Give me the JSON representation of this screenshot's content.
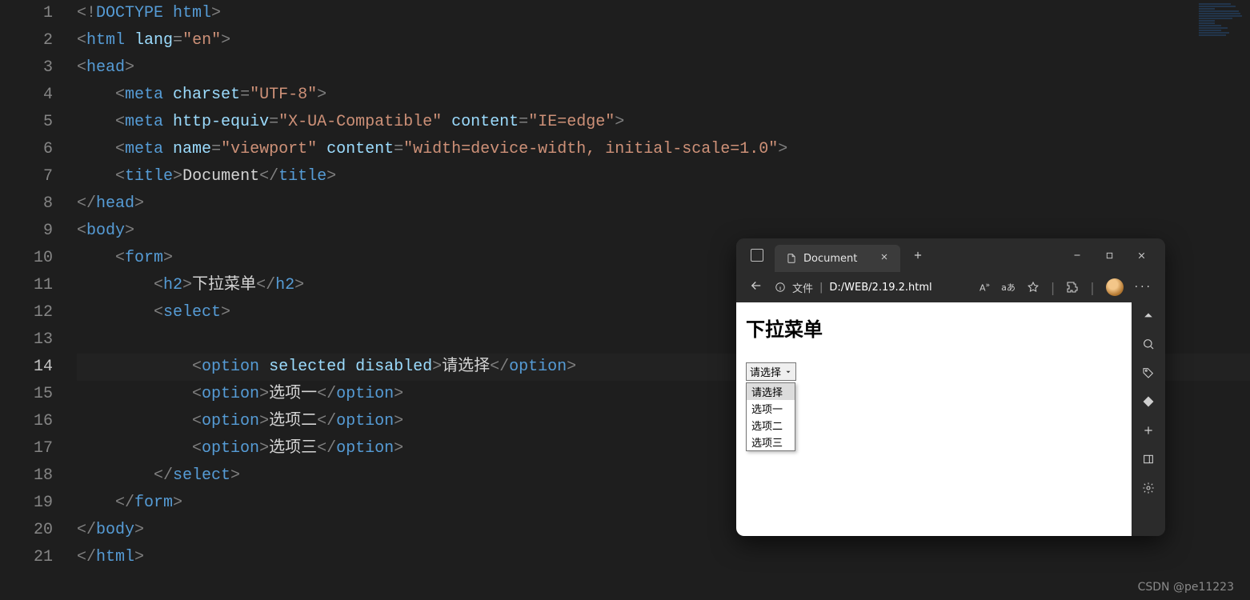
{
  "editor": {
    "currentLine": 14,
    "lines": [
      {
        "t": [
          [
            "brk",
            "<!"
          ],
          [
            "doctype",
            "DOCTYPE "
          ],
          [
            "tag",
            "html"
          ],
          [
            "brk",
            ">"
          ]
        ]
      },
      {
        "t": [
          [
            "brk",
            "<"
          ],
          [
            "tag",
            "html "
          ],
          [
            "attr",
            "lang"
          ],
          [
            "brk",
            "="
          ],
          [
            "str",
            "\"en\""
          ],
          [
            "brk",
            ">"
          ]
        ]
      },
      {
        "t": [
          [
            "brk",
            "<"
          ],
          [
            "tag",
            "head"
          ],
          [
            "brk",
            ">"
          ]
        ]
      },
      {
        "indent": 1,
        "t": [
          [
            "brk",
            "<"
          ],
          [
            "tag",
            "meta "
          ],
          [
            "attr",
            "charset"
          ],
          [
            "brk",
            "="
          ],
          [
            "str",
            "\"UTF-8\""
          ],
          [
            "brk",
            ">"
          ]
        ]
      },
      {
        "indent": 1,
        "t": [
          [
            "brk",
            "<"
          ],
          [
            "tag",
            "meta "
          ],
          [
            "attr",
            "http-equiv"
          ],
          [
            "brk",
            "="
          ],
          [
            "str",
            "\"X-UA-Compatible\""
          ],
          [
            "txt",
            " "
          ],
          [
            "attr",
            "content"
          ],
          [
            "brk",
            "="
          ],
          [
            "str",
            "\"IE=edge\""
          ],
          [
            "brk",
            ">"
          ]
        ]
      },
      {
        "indent": 1,
        "t": [
          [
            "brk",
            "<"
          ],
          [
            "tag",
            "meta "
          ],
          [
            "attr",
            "name"
          ],
          [
            "brk",
            "="
          ],
          [
            "str",
            "\"viewport\""
          ],
          [
            "txt",
            " "
          ],
          [
            "attr",
            "content"
          ],
          [
            "brk",
            "="
          ],
          [
            "str",
            "\"width=device-width, initial-scale=1.0\""
          ],
          [
            "brk",
            ">"
          ]
        ]
      },
      {
        "indent": 1,
        "t": [
          [
            "brk",
            "<"
          ],
          [
            "tag",
            "title"
          ],
          [
            "brk",
            ">"
          ],
          [
            "txt",
            "Document"
          ],
          [
            "brk",
            "</"
          ],
          [
            "tag",
            "title"
          ],
          [
            "brk",
            ">"
          ]
        ]
      },
      {
        "t": [
          [
            "brk",
            "</"
          ],
          [
            "tag",
            "head"
          ],
          [
            "brk",
            ">"
          ]
        ]
      },
      {
        "t": [
          [
            "brk",
            "<"
          ],
          [
            "tag",
            "body"
          ],
          [
            "brk",
            ">"
          ]
        ]
      },
      {
        "indent": 1,
        "t": [
          [
            "brk",
            "<"
          ],
          [
            "tag",
            "form"
          ],
          [
            "brk",
            ">"
          ]
        ]
      },
      {
        "indent": 2,
        "t": [
          [
            "brk",
            "<"
          ],
          [
            "tag",
            "h2"
          ],
          [
            "brk",
            ">"
          ],
          [
            "txt",
            "下拉菜单"
          ],
          [
            "brk",
            "</"
          ],
          [
            "tag",
            "h2"
          ],
          [
            "brk",
            ">"
          ]
        ]
      },
      {
        "indent": 2,
        "t": [
          [
            "brk",
            "<"
          ],
          [
            "tag",
            "select"
          ],
          [
            "brk",
            ">"
          ]
        ]
      },
      {
        "indent": 2,
        "t": []
      },
      {
        "indent": 3,
        "t": [
          [
            "brk",
            "<"
          ],
          [
            "tag",
            "option "
          ],
          [
            "attr",
            "selected "
          ],
          [
            "attr",
            "disabled"
          ],
          [
            "brk",
            ">"
          ],
          [
            "txt",
            "请选择"
          ],
          [
            "brk",
            "</"
          ],
          [
            "tag",
            "option"
          ],
          [
            "brk",
            ">"
          ]
        ]
      },
      {
        "indent": 3,
        "t": [
          [
            "brk",
            "<"
          ],
          [
            "tag",
            "option"
          ],
          [
            "brk",
            ">"
          ],
          [
            "txt",
            "选项一"
          ],
          [
            "brk",
            "</"
          ],
          [
            "tag",
            "option"
          ],
          [
            "brk",
            ">"
          ]
        ]
      },
      {
        "indent": 3,
        "t": [
          [
            "brk",
            "<"
          ],
          [
            "tag",
            "option"
          ],
          [
            "brk",
            ">"
          ],
          [
            "txt",
            "选项二"
          ],
          [
            "brk",
            "</"
          ],
          [
            "tag",
            "option"
          ],
          [
            "brk",
            ">"
          ]
        ]
      },
      {
        "indent": 3,
        "t": [
          [
            "brk",
            "<"
          ],
          [
            "tag",
            "option"
          ],
          [
            "brk",
            ">"
          ],
          [
            "txt",
            "选项三"
          ],
          [
            "brk",
            "</"
          ],
          [
            "tag",
            "option"
          ],
          [
            "brk",
            ">"
          ]
        ]
      },
      {
        "indent": 2,
        "t": [
          [
            "brk",
            "</"
          ],
          [
            "tag",
            "select"
          ],
          [
            "brk",
            ">"
          ]
        ]
      },
      {
        "indent": 1,
        "t": [
          [
            "brk",
            "</"
          ],
          [
            "tag",
            "form"
          ],
          [
            "brk",
            ">"
          ]
        ]
      },
      {
        "t": [
          [
            "brk",
            "</"
          ],
          [
            "tag",
            "body"
          ],
          [
            "brk",
            ">"
          ]
        ]
      },
      {
        "t": [
          [
            "brk",
            "</"
          ],
          [
            "tag",
            "html"
          ],
          [
            "brk",
            ">"
          ]
        ]
      }
    ]
  },
  "browser": {
    "tabTitle": "Document",
    "urlLabel": "文件",
    "urlPath": "D:/WEB/2.19.2.html",
    "pageHeading": "下拉菜单",
    "selectedOption": "请选择",
    "options": [
      "请选择",
      "选项一",
      "选项二",
      "选项三"
    ]
  },
  "watermark": "CSDN @pe11223"
}
